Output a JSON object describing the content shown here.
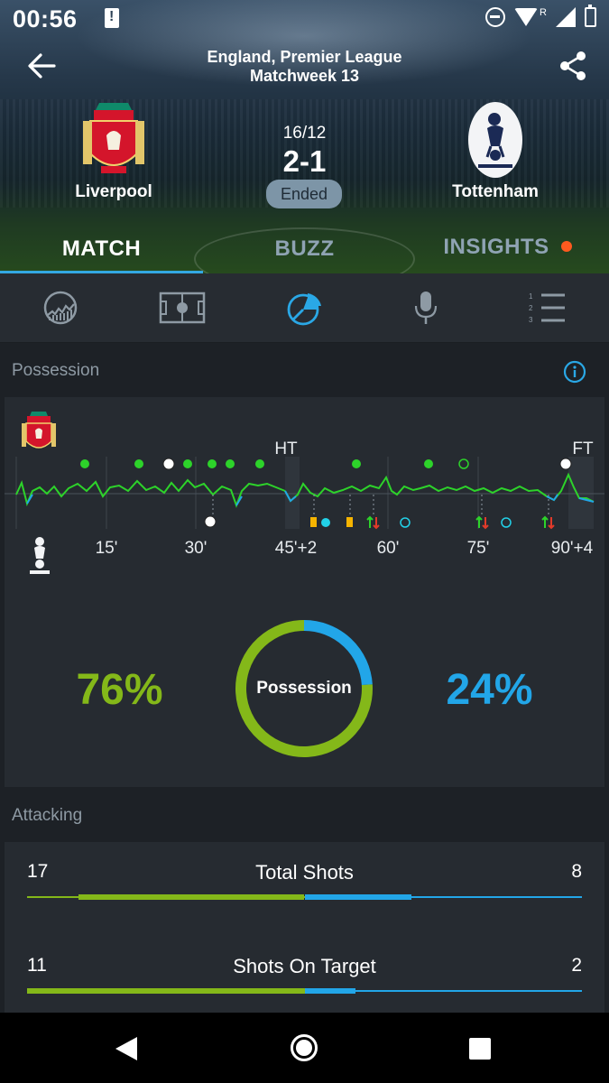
{
  "status_bar": {
    "time": "00:56"
  },
  "header": {
    "league": "England, Premier League",
    "matchweek": "Matchweek 13",
    "date": "16/12",
    "score": "2-1",
    "status": "Ended",
    "home_team": "Liverpool",
    "away_team": "Tottenham"
  },
  "tabs": [
    {
      "label": "MATCH",
      "active": true
    },
    {
      "label": "BUZZ",
      "active": false
    },
    {
      "label": "INSIGHTS",
      "active": false,
      "notification_dot": true
    }
  ],
  "icon_tabs": [
    "momentum-icon",
    "pitch-icon",
    "pie-chart-icon",
    "microphone-icon",
    "ranked-list-icon"
  ],
  "possession": {
    "section_title": "Possession",
    "home_pct": "76%",
    "away_pct": "24%",
    "home_value": 76,
    "away_value": 24,
    "ring_label": "Possession",
    "home_color": "#84b819",
    "away_color": "#22a6e8",
    "timeline": {
      "tick_labels": [
        "15'",
        "30'",
        "45'+2",
        "60'",
        "75'",
        "90'+4"
      ],
      "period_labels": [
        "HT",
        "FT"
      ]
    }
  },
  "attacking": {
    "section_title": "Attacking",
    "stats": [
      {
        "label": "Total Shots",
        "home": "17",
        "away": "8",
        "home_value": 17,
        "away_value": 8
      },
      {
        "label": "Shots On Target",
        "home": "11",
        "away": "2",
        "home_value": 11,
        "away_value": 2
      }
    ]
  }
}
